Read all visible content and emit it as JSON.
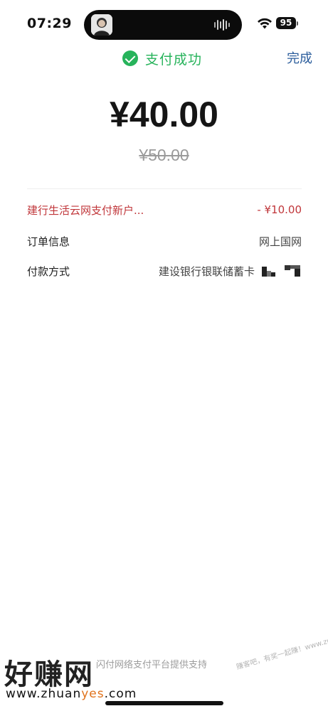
{
  "status_bar": {
    "time": "07:29",
    "battery": "95",
    "icons": [
      "wifi-icon",
      "battery-icon",
      "audio-wave-icon"
    ]
  },
  "header": {
    "success_label": "支付成功",
    "done_label": "完成",
    "success_color": "#27b35b",
    "link_color": "#2b5d9c"
  },
  "amount": {
    "paid": "¥40.00",
    "original": "¥50.00"
  },
  "details": {
    "discount_label": "建行生活云网支付新户...",
    "discount_value": "- ¥10.00",
    "discount_color": "#c0363a",
    "order_label": "订单信息",
    "order_value": "网上国网",
    "pay_label": "付款方式",
    "pay_value": "建设银行银联储蓄卡"
  },
  "footer": {
    "support_text": "闪付网络支付平台提供支持"
  },
  "watermark": {
    "logo": "好赚网",
    "url_prefix": "www.zhuan",
    "url_highlight": "yes",
    "url_suffix": ".com",
    "side_text": "赚客吧，有奖一起赚！www.zuanke8.com"
  }
}
